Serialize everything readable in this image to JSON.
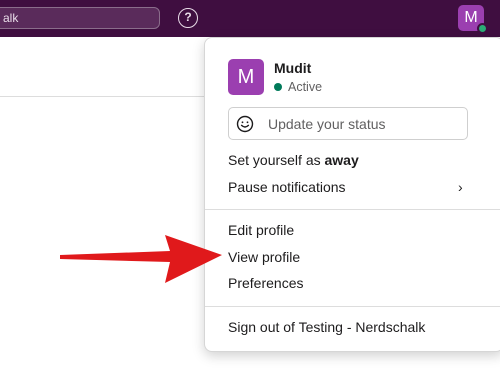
{
  "topbar": {
    "search_text": "alk",
    "help_glyph": "?",
    "avatar_letter": "M"
  },
  "menu": {
    "user": {
      "avatar_letter": "M",
      "name": "Mudit",
      "status": "Active"
    },
    "status_input": {
      "placeholder": "Update your status"
    },
    "set_away": {
      "prefix": "Set yourself as ",
      "bold": "away"
    },
    "pause_notifications": "Pause notifications",
    "edit_profile": "Edit profile",
    "view_profile": "View profile",
    "preferences": "Preferences",
    "sign_out": "Sign out of Testing - Nerdschalk"
  },
  "colors": {
    "topbar": "#3f0e40",
    "avatar": "#9b3fb0",
    "active_green": "#007a5a",
    "arrow": "#e0191b"
  },
  "icons": [
    "help-icon",
    "smiley-icon",
    "chevron-right-icon",
    "arrow-annotation"
  ]
}
